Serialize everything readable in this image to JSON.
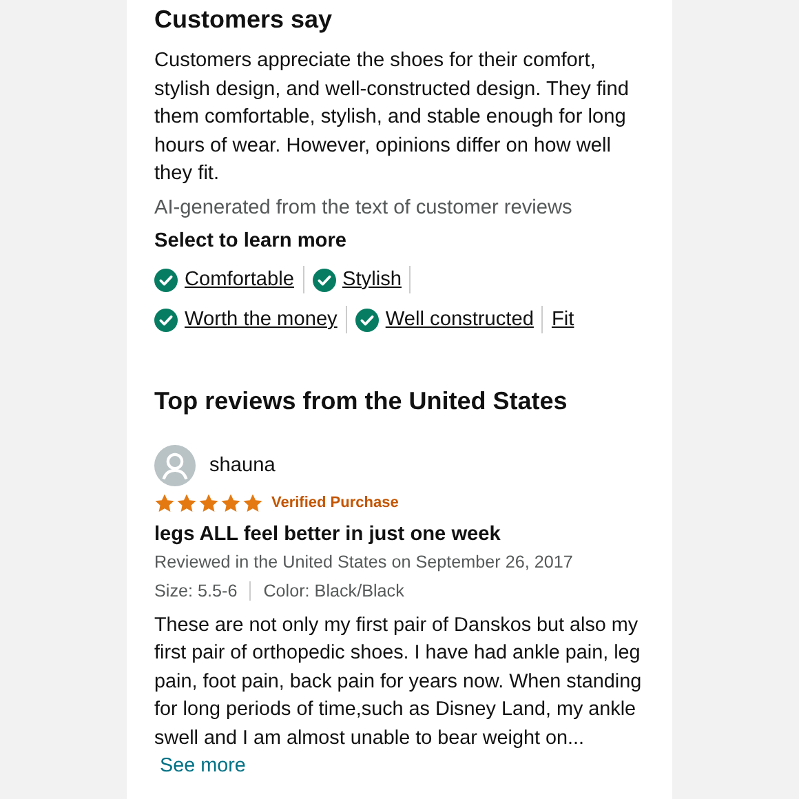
{
  "customers_say": {
    "heading": "Customers say",
    "summary": "Customers appreciate the shoes for their comfort, stylish design, and well-constructed design. They find them comfortable, stylish, and stable enough for long hours of wear. However, opinions differ on how well they fit.",
    "note": "AI-generated from the text of customer reviews",
    "prompt": "Select to learn more",
    "aspect_rows": [
      [
        {
          "label": "Comfortable",
          "checked": true
        },
        {
          "label": "Stylish",
          "checked": true
        }
      ],
      [
        {
          "label": "Worth the money",
          "checked": true
        },
        {
          "label": "Well constructed",
          "checked": true
        },
        {
          "label": "Fit",
          "checked": false
        }
      ]
    ]
  },
  "top_reviews": {
    "heading": "Top reviews from the United States",
    "reviews": [
      {
        "author": "shauna",
        "stars": 5,
        "badge": "Verified Purchase",
        "title": "legs ALL feel better in just one week",
        "reviewed": "Reviewed in the United States on September 26, 2017",
        "size": "Size: 5.5-6",
        "variant": "Color: Black/Black",
        "body": "These are not only my first pair of Danskos but also my first pair of orthopedic shoes. I have had ankle pain, leg pain, foot pain, back pain for years now. When standing for long periods of time,such as Disney Land, my ankle swell and I am almost unable to bear weight on...",
        "more": "See more"
      }
    ]
  }
}
